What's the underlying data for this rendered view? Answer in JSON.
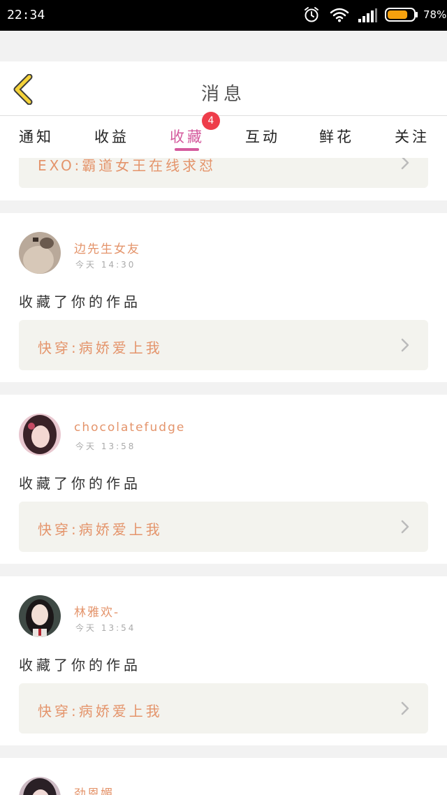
{
  "status_bar": {
    "time": "22:34",
    "battery_percent": "78%",
    "battery_level": 0.78,
    "icons": [
      "alarm-icon",
      "wifi-icon",
      "signal-icon",
      "battery-icon"
    ]
  },
  "header": {
    "title": "消息",
    "back_icon": "chevron-left-icon"
  },
  "tabs": [
    {
      "label": "通知",
      "active": false
    },
    {
      "label": "收益",
      "active": false
    },
    {
      "label": "收藏",
      "active": true,
      "badge": "4"
    },
    {
      "label": "互动",
      "active": false
    },
    {
      "label": "鲜花",
      "active": false
    },
    {
      "label": "关注",
      "active": false
    }
  ],
  "colors": {
    "accent": "#d45a9d",
    "badge": "#ee3d4a",
    "username": "#e4946b",
    "work_box": "#f3f3ee",
    "back_icon": "#f5d33a"
  },
  "items": [
    {
      "work_title": "EXO:霸道女王在线求怼"
    },
    {
      "username": "边先生女友",
      "time": "今天 14:30",
      "action": "收藏了你的作品",
      "work_title": "快穿:病娇爱上我"
    },
    {
      "username": "chocolatefudge",
      "time": "今天 13:58",
      "action": "收藏了你的作品",
      "work_title": "快穿:病娇爱上我"
    },
    {
      "username": "林雅欢-",
      "time": "今天 13:54",
      "action": "收藏了你的作品",
      "work_title": "快穿:病娇爱上我"
    },
    {
      "username": "劲恩媚"
    }
  ]
}
